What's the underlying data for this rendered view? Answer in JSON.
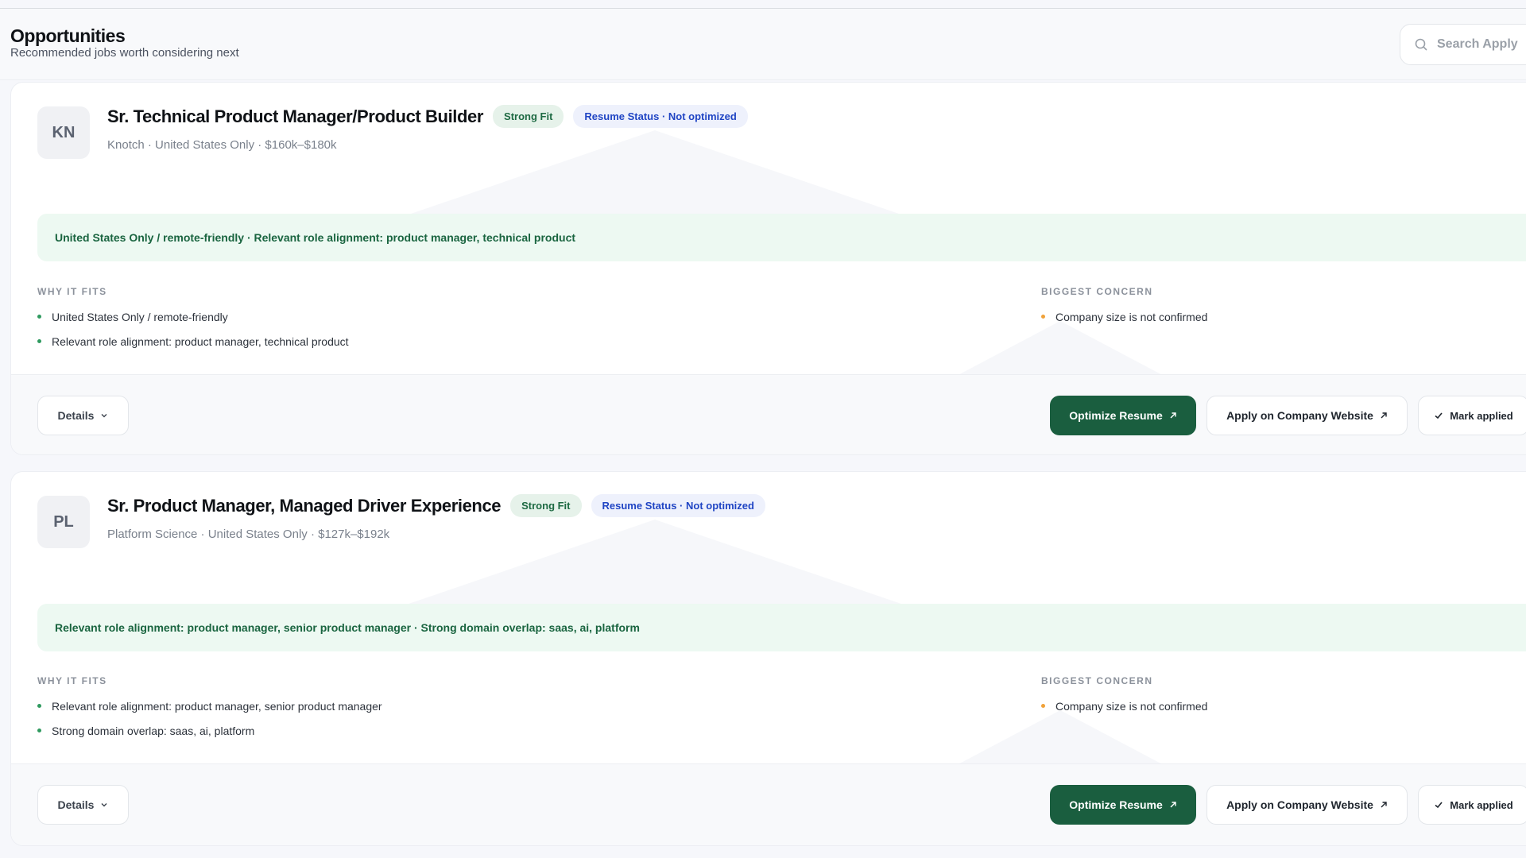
{
  "header": {
    "title": "Opportunities",
    "subtitle": "Recommended jobs worth considering next",
    "search_placeholder": "Search Apply"
  },
  "colors": {
    "accent": "#1a5e3f",
    "fit_badge_bg": "#e6f2ea",
    "resume_badge_text": "#2045c4",
    "highlight_bg": "#edf9f2",
    "concern_dot": "#f0a23a"
  },
  "icons": {
    "search": "search-icon",
    "chevron": "chevron-down-icon",
    "external": "arrow-up-right-icon",
    "check": "check-icon"
  },
  "section_labels": {
    "why_it_fits": "WHY IT FITS",
    "biggest_concern": "BIGGEST CONCERN"
  },
  "buttons": {
    "details": "Details",
    "optimize_resume": "Optimize Resume",
    "apply_company": "Apply on Company Website",
    "mark_applied": "Mark applied"
  },
  "jobs": [
    {
      "initials": "KN",
      "title": "Sr. Technical Product Manager/Product Builder",
      "fit_badge": "Strong Fit",
      "resume_status": "Resume Status · Not optimized",
      "meta": "Knotch · United States Only · $160k–$180k",
      "highlight": "United States Only / remote-friendly · Relevant role alignment: product manager, technical product",
      "fits": [
        "United States Only / remote-friendly",
        "Relevant role alignment: product manager, technical product"
      ],
      "concerns": [
        "Company size is not confirmed"
      ]
    },
    {
      "initials": "PL",
      "title": "Sr. Product Manager, Managed Driver Experience",
      "fit_badge": "Strong Fit",
      "resume_status": "Resume Status · Not optimized",
      "meta": "Platform Science · United States Only · $127k–$192k",
      "highlight": "Relevant role alignment: product manager, senior product manager · Strong domain overlap: saas, ai, platform",
      "fits": [
        "Relevant role alignment: product manager, senior product manager",
        "Strong domain overlap: saas, ai, platform"
      ],
      "concerns": [
        "Company size is not confirmed"
      ]
    }
  ]
}
